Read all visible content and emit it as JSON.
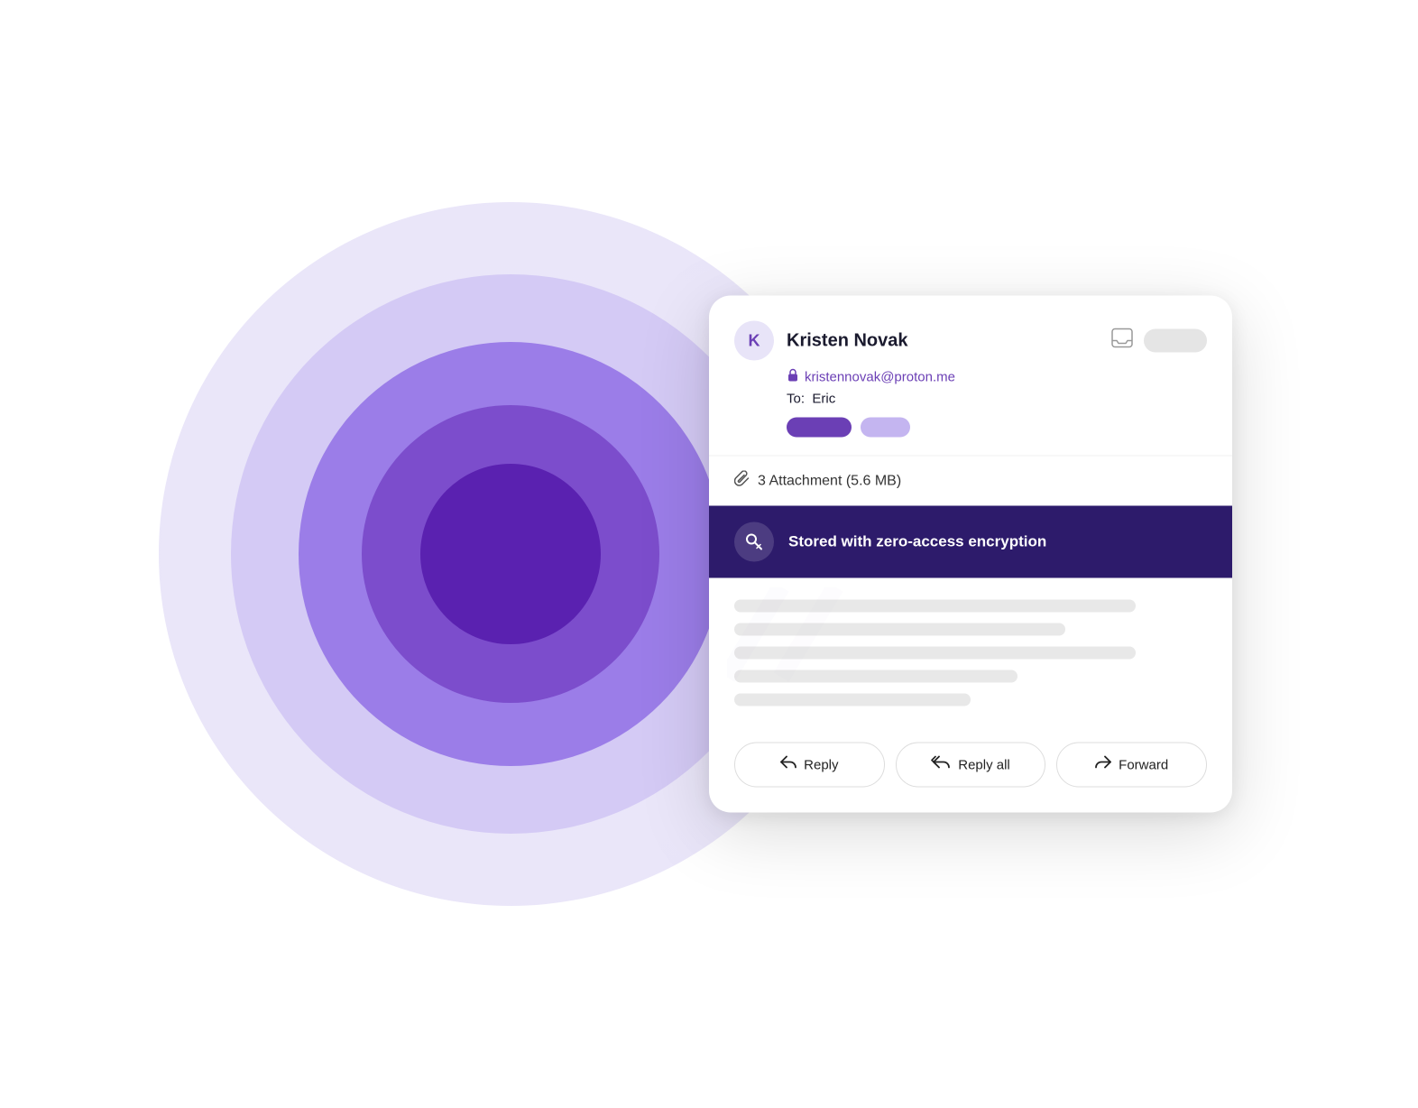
{
  "background": {
    "circles": [
      {
        "size": 780,
        "color": "#ede9fb"
      },
      {
        "size": 620,
        "color": "#d4caf5"
      },
      {
        "size": 470,
        "color": "#9b7de8"
      },
      {
        "size": 330,
        "color": "#7c4dcc"
      },
      {
        "size": 200,
        "color": "#5a21b0"
      }
    ]
  },
  "email": {
    "avatar_letter": "K",
    "sender_name": "Kristen Novak",
    "sender_email": "kristennovak@proton.me",
    "to_label": "To:",
    "to_recipient": "Eric",
    "attachment_text": "3 Attachment (5.6 MB)",
    "encryption_banner": "Stored with zero-access encryption",
    "reply_button": "Reply",
    "reply_all_button": "Reply all",
    "forward_button": "Forward"
  },
  "icons": {
    "lock": "🔒",
    "clip": "📎",
    "key": "🔑",
    "inbox": "⊠",
    "reply": "↩",
    "reply_all": "↩↩",
    "forward": "↪"
  }
}
